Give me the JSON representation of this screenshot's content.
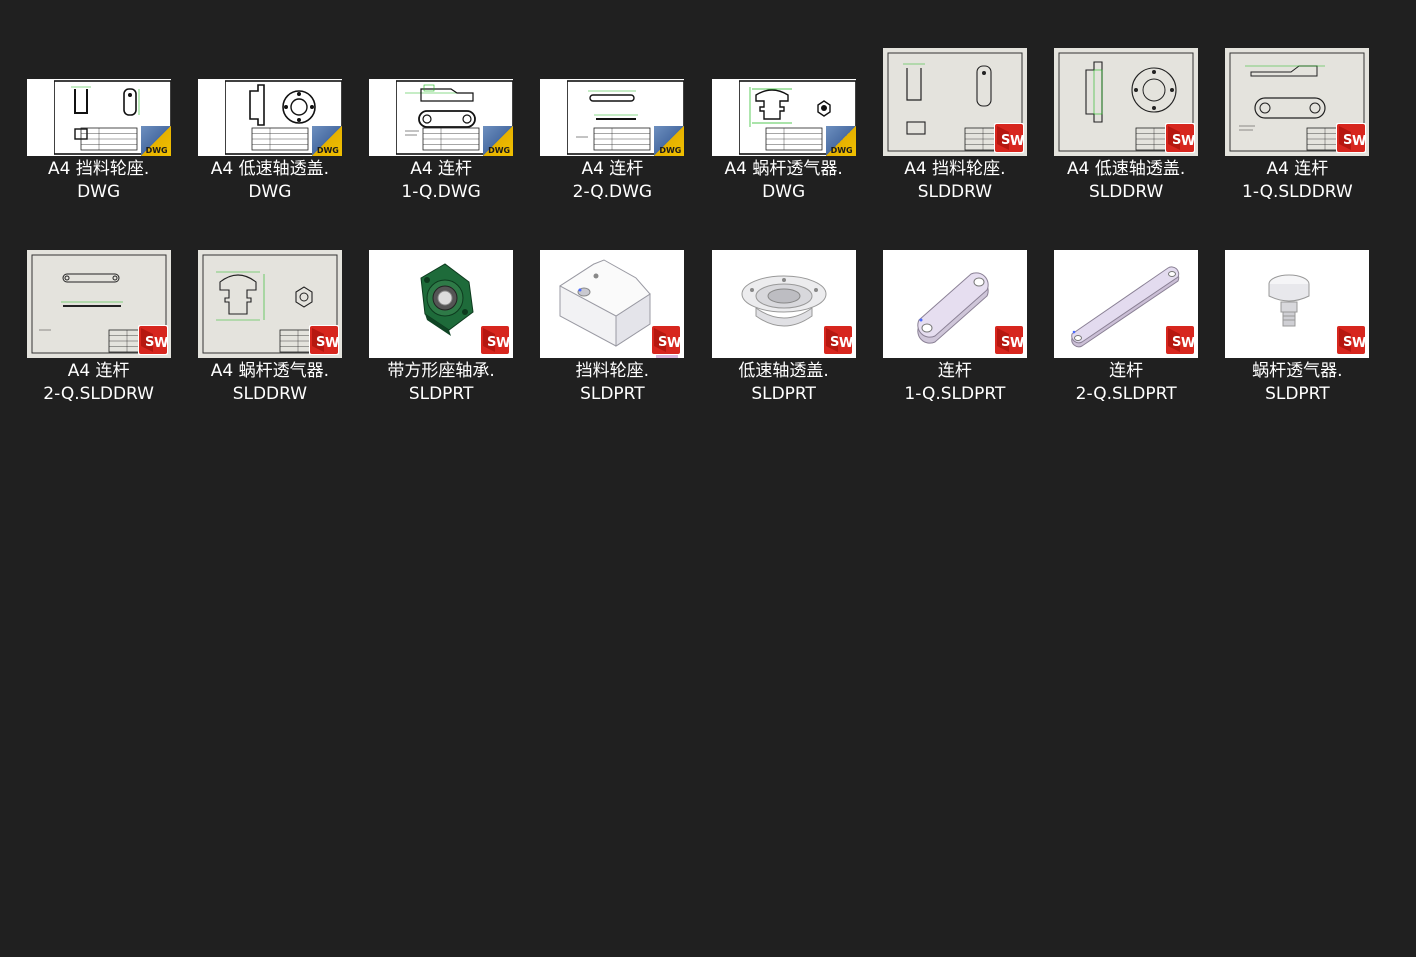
{
  "rows": [
    [
      {
        "line1": "A4 挡料轮座.",
        "line2": "DWG",
        "kind": "dwg",
        "icon": "dwg-file-icon"
      },
      {
        "line1": "A4 低速轴透盖.",
        "line2": "DWG",
        "kind": "dwg",
        "icon": "dwg-file-icon"
      },
      {
        "line1": "A4 连杆",
        "line2": "1-Q.DWG",
        "kind": "dwg",
        "icon": "dwg-file-icon"
      },
      {
        "line1": "A4 连杆",
        "line2": "2-Q.DWG",
        "kind": "dwg",
        "icon": "dwg-file-icon"
      },
      {
        "line1": "A4 蜗杆透气器.",
        "line2": "DWG",
        "kind": "dwg",
        "icon": "dwg-file-icon"
      },
      {
        "line1": "A4 挡料轮座.",
        "line2": "SLDDRW",
        "kind": "drw",
        "icon": "solidworks-drawing-icon"
      },
      {
        "line1": "A4 低速轴透盖.",
        "line2": "SLDDRW",
        "kind": "drw",
        "icon": "solidworks-drawing-icon"
      },
      {
        "line1": "A4 连杆",
        "line2": "1-Q.SLDDRW",
        "kind": "drw",
        "icon": "solidworks-drawing-icon"
      }
    ],
    [
      {
        "line1": "A4 连杆",
        "line2": "2-Q.SLDDRW",
        "kind": "drw",
        "icon": "solidworks-drawing-icon"
      },
      {
        "line1": "A4 蜗杆透气器.",
        "line2": "SLDDRW",
        "kind": "drw",
        "icon": "solidworks-drawing-icon"
      },
      {
        "line1": "带方形座轴承.",
        "line2": "SLDPRT",
        "kind": "prt",
        "icon": "solidworks-part-icon"
      },
      {
        "line1": "挡料轮座.",
        "line2": "SLDPRT",
        "kind": "prt",
        "icon": "solidworks-part-icon"
      },
      {
        "line1": "低速轴透盖.",
        "line2": "SLDPRT",
        "kind": "prt",
        "icon": "solidworks-part-icon"
      },
      {
        "line1": "连杆",
        "line2": "1-Q.SLDPRT",
        "kind": "prt",
        "icon": "solidworks-part-icon"
      },
      {
        "line1": "连杆",
        "line2": "2-Q.SLDPRT",
        "kind": "prt",
        "icon": "solidworks-part-icon"
      },
      {
        "line1": "蜗杆透气器.",
        "line2": "SLDPRT",
        "kind": "prt",
        "icon": "solidworks-part-icon"
      }
    ]
  ],
  "badges": {
    "dwg_text": "DWG"
  },
  "colors": {
    "background": "#202020",
    "label": "#ffffff",
    "sw_red": "#d7261e",
    "dwg_yellow": "#f0c000",
    "dwg_blue": "#4a6da3",
    "drawing_paper": "#e4e3dd",
    "dim_green": "#00b000"
  }
}
